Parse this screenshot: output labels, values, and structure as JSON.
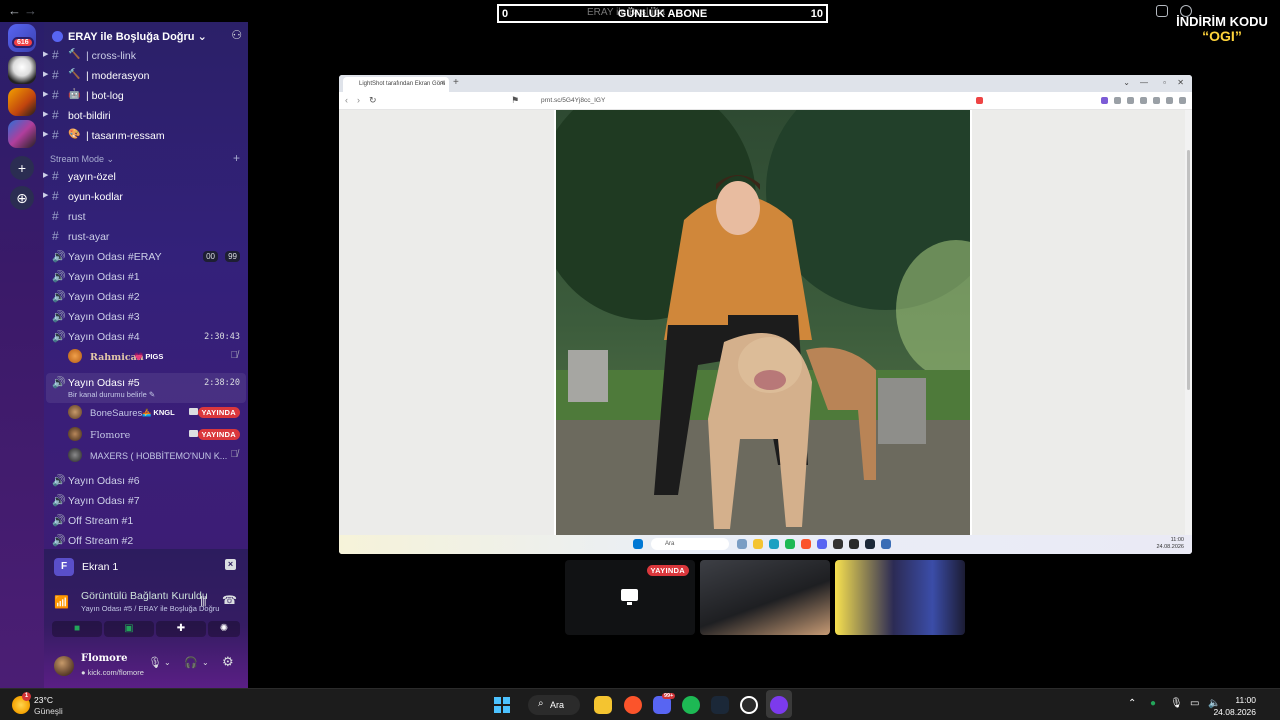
{
  "topbar": {
    "sub_bar": {
      "left_value": "0",
      "right_value": "10",
      "title": "GÜNLÜK ABONE",
      "ghost_text": "ERAY ile Boşluğa"
    },
    "discount": {
      "line1": "İNDİRİM KODU",
      "line2": "“OGI”"
    },
    "back_arrow": "←",
    "forward_arrow": "→"
  },
  "rail": {
    "badge": "616",
    "add_icon": "+",
    "explore_icon": "⊕"
  },
  "server": {
    "name": "ERAY ile Boşluğa Doğru",
    "chevron": "⌄",
    "invite_icon": "⚇"
  },
  "channels_top": [
    {
      "emoji": "🔨",
      "name": "| cross-link"
    },
    {
      "emoji": "🔨",
      "name": "| moderasyon"
    },
    {
      "emoji": "🤖",
      "name": "| bot-log"
    },
    {
      "emoji": "",
      "name": "bot-bildiri"
    },
    {
      "emoji": "🎨",
      "name": "| tasarım-ressam"
    }
  ],
  "section": {
    "name": "Stream Mode",
    "chevron": "⌄",
    "plus": "+"
  },
  "channels": {
    "yayin_ozel": "yayın-özel",
    "oyun_kodlar": "oyun-kodlar",
    "rust": "rust",
    "rust_ayar": "rust-ayar",
    "odasi_eray": "Yayın Odası #ERAY",
    "odasi_eray_cnt_a": "00",
    "odasi_eray_cnt_b": "99",
    "odasi_1": "Yayın Odası #1",
    "odasi_2": "Yayın Odası #2",
    "odasi_3": "Yayın Odası #3",
    "odasi_4": "Yayın Odası #4",
    "odasi_4_time": "2:30:43",
    "odasi_5": "Yayın Odası #5",
    "odasi_5_time": "2:38:20",
    "odasi_5_status": "Bir kanal durumu belirle ✎",
    "odasi_6": "Yayın Odası #6",
    "odasi_7": "Yayın Odası #7",
    "off_1": "Off Stream #1",
    "off_2": "Off Stream #2"
  },
  "members": {
    "rahmican": {
      "name": "Rahmican",
      "tag": "💗 PIGS"
    },
    "bonesaures": {
      "name": "BoneSaures",
      "tag": "🚣 KNGL",
      "badge": "YAYINDA"
    },
    "flomore": {
      "name": "Flomore",
      "badge": "YAYINDA"
    },
    "maxers": {
      "name": "MAXERS ( HOBBİTEMO'NUN K..."
    }
  },
  "voice": {
    "screen_tile": "F",
    "screen_name": "Ekran 1",
    "conn_title": "Görüntülü Bağlantı Kuruldu",
    "conn_sub": "Yayın Odası #5 / ERAY ile Boşluğa Doğru"
  },
  "user": {
    "name": "Flomore",
    "sub": "● kick.com/flomore"
  },
  "browser": {
    "tab_title": "LightShot tarafından Ekran Görü",
    "url": "prnt.sc/5G4Yj8cc_IGY",
    "search_placeholder": "Ara",
    "clock_time": "11:00",
    "clock_date": "24.08.2026"
  },
  "tiles": {
    "live_badge": "YAYINDA"
  },
  "taskbar": {
    "weather_temp": "23°C",
    "weather_desc": "Güneşli",
    "weather_badge": "1",
    "search_label": "Ara",
    "discord_badge": "99+",
    "time": "11:00",
    "date": "24.08.2026"
  },
  "colors": {
    "live_red": "#da373c",
    "accent": "#5865f2",
    "sidebar": "#33217a"
  }
}
